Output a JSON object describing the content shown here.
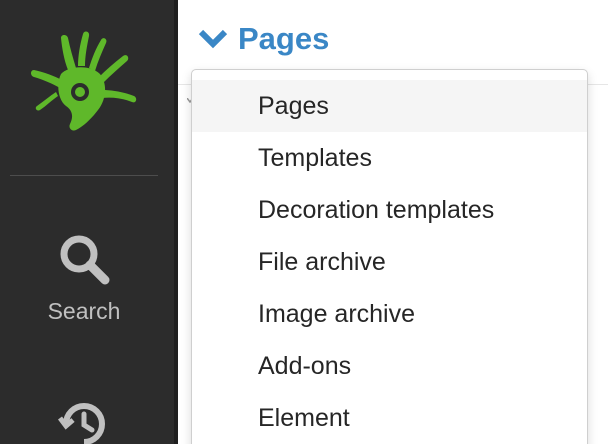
{
  "sidebar": {
    "logo_icon": "hand-logo-icon",
    "logo_color": "#5fb82a",
    "search_label": "Search",
    "search_icon": "search-icon",
    "history_icon": "history-clock-icon",
    "background": "#2c2c2c"
  },
  "header": {
    "title": "Pages",
    "chevron_icon": "chevron-down-icon",
    "accent_color": "#3a87c6"
  },
  "dropdown": {
    "selected": "Pages",
    "items": [
      {
        "label": "Pages"
      },
      {
        "label": "Templates"
      },
      {
        "label": "Decoration templates"
      },
      {
        "label": "File archive"
      },
      {
        "label": "Image archive"
      },
      {
        "label": "Add-ons"
      },
      {
        "label": "Element"
      }
    ]
  }
}
